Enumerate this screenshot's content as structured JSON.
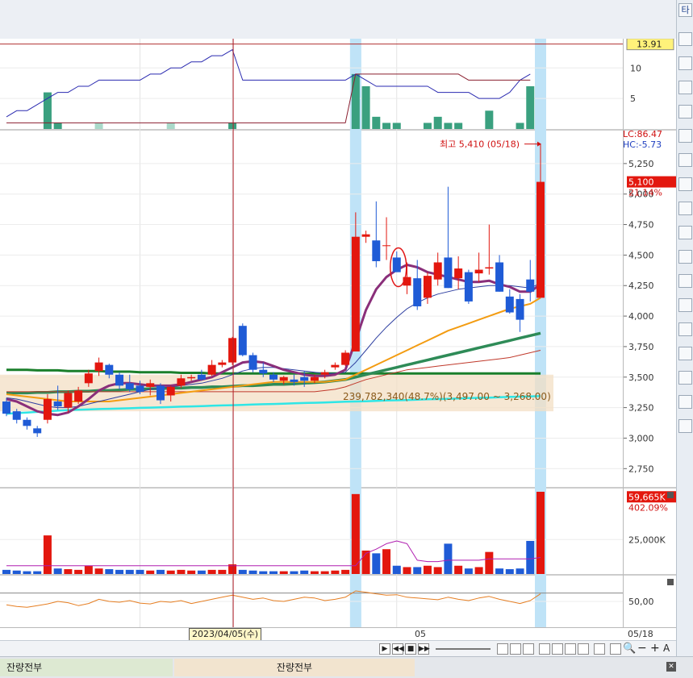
{
  "window": {
    "top_right_glyph": "타"
  },
  "bottom_tabs": [
    {
      "label": "잔량전부"
    },
    {
      "label": "잔량전부"
    }
  ],
  "date_axis": {
    "crosshair_date": "2023/04/05(수)",
    "mid_label": "05",
    "last_label": "05/18"
  },
  "colors": {
    "up": "#e3170e",
    "down": "#1f5bd6",
    "ma5": "#8a2f7a",
    "ma10": "#f39c12",
    "ma20": "#2e8b57",
    "ma60": "#1a7f2b",
    "ma120": "#c0392b",
    "ma_long": "#2ee6e6",
    "highlight": "#bfe3f7",
    "band": "#f3dfc4"
  },
  "chart_data": [
    {
      "type": "bar+line",
      "panel": "indicator-top",
      "yticks": [
        5,
        10
      ],
      "ylim": [
        0,
        14
      ],
      "current_value_label": "13.91",
      "bars": [
        0,
        0,
        0,
        0,
        6,
        1,
        0,
        0,
        0,
        1,
        0,
        0,
        0,
        0,
        0,
        0,
        1,
        0,
        0,
        0,
        0,
        0,
        1,
        0,
        0,
        0,
        0,
        0,
        0,
        0,
        0,
        0,
        0,
        0,
        9,
        7,
        2,
        1,
        1,
        0,
        0,
        1,
        2,
        1,
        1,
        0,
        0,
        3,
        0,
        0,
        1,
        7
      ],
      "line1": [
        2,
        3,
        3,
        4,
        5,
        6,
        6,
        7,
        7,
        8,
        8,
        8,
        8,
        8,
        9,
        9,
        10,
        10,
        11,
        11,
        12,
        12,
        13,
        8,
        8,
        8,
        8,
        8,
        8,
        8,
        8,
        8,
        8,
        8,
        9,
        8,
        7,
        7,
        7,
        7,
        7,
        7,
        6,
        6,
        6,
        6,
        5,
        5,
        5,
        6,
        8,
        9
      ],
      "line2": [
        1,
        1,
        1,
        1,
        1,
        1,
        1,
        1,
        1,
        1,
        1,
        1,
        1,
        1,
        1,
        1,
        1,
        1,
        1,
        1,
        1,
        1,
        1,
        1,
        1,
        1,
        1,
        1,
        1,
        1,
        1,
        1,
        1,
        1,
        9,
        9,
        9,
        9,
        9,
        9,
        9,
        9,
        9,
        9,
        9,
        8,
        8,
        8,
        8,
        8,
        8,
        8
      ]
    },
    {
      "type": "candlestick",
      "panel": "price",
      "yticks": [
        2750,
        3000,
        3250,
        3500,
        3750,
        4000,
        4250,
        4500,
        4750,
        5000,
        5250
      ],
      "ylim": [
        2600,
        5520
      ],
      "lc_label": "LC:86.47",
      "hc_label": "HC:-5.73",
      "current_price_label": "5,100",
      "current_change_label": "21.14%",
      "annotation_max": "최고 5,410 (05/18)",
      "annotation_range": "239,782,340(48.7%)(3,497.00 ~ 3,268.00)",
      "ohlc": [
        [
          3300,
          3330,
          3180,
          3200
        ],
        [
          3220,
          3240,
          3120,
          3150
        ],
        [
          3150,
          3170,
          3070,
          3100
        ],
        [
          3080,
          3100,
          3010,
          3040
        ],
        [
          3150,
          3360,
          3120,
          3320
        ],
        [
          3300,
          3430,
          3230,
          3260
        ],
        [
          3250,
          3390,
          3210,
          3370
        ],
        [
          3300,
          3420,
          3280,
          3390
        ],
        [
          3450,
          3560,
          3420,
          3530
        ],
        [
          3550,
          3660,
          3510,
          3620
        ],
        [
          3600,
          3610,
          3490,
          3520
        ],
        [
          3520,
          3540,
          3400,
          3430
        ],
        [
          3450,
          3520,
          3380,
          3400
        ],
        [
          3430,
          3470,
          3360,
          3380
        ],
        [
          3420,
          3480,
          3350,
          3450
        ],
        [
          3430,
          3450,
          3280,
          3310
        ],
        [
          3350,
          3430,
          3300,
          3420
        ],
        [
          3430,
          3520,
          3410,
          3490
        ],
        [
          3490,
          3520,
          3470,
          3500
        ],
        [
          3520,
          3560,
          3470,
          3480
        ],
        [
          3520,
          3640,
          3510,
          3600
        ],
        [
          3600,
          3640,
          3580,
          3620
        ],
        [
          3620,
          3830,
          3600,
          3820
        ],
        [
          3920,
          3940,
          3670,
          3680
        ],
        [
          3680,
          3700,
          3540,
          3560
        ],
        [
          3560,
          3620,
          3500,
          3530
        ],
        [
          3520,
          3540,
          3460,
          3480
        ],
        [
          3470,
          3510,
          3440,
          3500
        ],
        [
          3480,
          3520,
          3430,
          3460
        ],
        [
          3500,
          3550,
          3420,
          3470
        ],
        [
          3470,
          3520,
          3450,
          3500
        ],
        [
          3520,
          3560,
          3490,
          3540
        ],
        [
          3580,
          3620,
          3560,
          3600
        ],
        [
          3600,
          3720,
          3590,
          3700
        ],
        [
          3710,
          4850,
          3710,
          4650
        ],
        [
          4650,
          4700,
          4600,
          4670
        ],
        [
          4620,
          4940,
          4400,
          4450
        ],
        [
          4580,
          4810,
          4460,
          4580
        ],
        [
          4480,
          4530,
          4360,
          4360
        ],
        [
          4250,
          4440,
          4180,
          4320
        ],
        [
          4310,
          4460,
          4050,
          4080
        ],
        [
          4150,
          4360,
          4100,
          4330
        ],
        [
          4300,
          4520,
          4250,
          4440
        ],
        [
          4480,
          5060,
          4230,
          4230
        ],
        [
          4310,
          4490,
          4220,
          4390
        ],
        [
          4360,
          4380,
          4100,
          4120
        ],
        [
          4350,
          4520,
          4280,
          4380
        ],
        [
          4390,
          4750,
          4340,
          4400
        ],
        [
          4440,
          4500,
          4200,
          4200
        ],
        [
          4160,
          4220,
          4020,
          4030
        ],
        [
          4140,
          4180,
          3870,
          3970
        ],
        [
          4300,
          4460,
          4120,
          4200
        ],
        [
          4150,
          5410,
          4150,
          5100
        ]
      ],
      "ma5": [
        3320,
        3300,
        3260,
        3220,
        3200,
        3190,
        3210,
        3260,
        3320,
        3390,
        3430,
        3450,
        3450,
        3440,
        3430,
        3430,
        3430,
        3440,
        3460,
        3480,
        3500,
        3540,
        3580,
        3620,
        3630,
        3620,
        3590,
        3560,
        3540,
        3520,
        3510,
        3510,
        3520,
        3560,
        3800,
        4050,
        4220,
        4320,
        4380,
        4420,
        4400,
        4360,
        4340,
        4320,
        4300,
        4280,
        4280,
        4290,
        4260,
        4240,
        4200,
        4200,
        4260
      ],
      "ma10": [
        3330,
        3320,
        3300,
        3280,
        3260,
        3250,
        3250,
        3260,
        3280,
        3300,
        3320,
        3340,
        3360,
        3380,
        3400,
        3410,
        3420,
        3430,
        3440,
        3450,
        3470,
        3490,
        3520,
        3550,
        3570,
        3580,
        3580,
        3570,
        3560,
        3550,
        3540,
        3530,
        3530,
        3540,
        3620,
        3720,
        3820,
        3910,
        3990,
        4060,
        4110,
        4150,
        4180,
        4200,
        4220,
        4230,
        4240,
        4250,
        4250,
        4250,
        4240,
        4230,
        4270
      ],
      "ma20": [
        3360,
        3350,
        3340,
        3330,
        3320,
        3310,
        3300,
        3300,
        3300,
        3300,
        3300,
        3310,
        3320,
        3330,
        3340,
        3350,
        3360,
        3370,
        3380,
        3390,
        3400,
        3410,
        3420,
        3430,
        3440,
        3450,
        3460,
        3460,
        3460,
        3460,
        3460,
        3460,
        3470,
        3480,
        3520,
        3560,
        3600,
        3640,
        3680,
        3720,
        3760,
        3800,
        3840,
        3880,
        3910,
        3940,
        3970,
        4000,
        4030,
        4060,
        4080,
        4100,
        4150
      ],
      "ma60": [
        3370,
        3370,
        3370,
        3375,
        3375,
        3380,
        3380,
        3385,
        3385,
        3390,
        3390,
        3395,
        3400,
        3400,
        3405,
        3405,
        3410,
        3410,
        3415,
        3415,
        3420,
        3420,
        3425,
        3430,
        3430,
        3435,
        3440,
        3440,
        3445,
        3450,
        3455,
        3460,
        3470,
        3480,
        3500,
        3520,
        3540,
        3560,
        3580,
        3600,
        3620,
        3640,
        3660,
        3680,
        3700,
        3720,
        3740,
        3760,
        3780,
        3800,
        3820,
        3840,
        3860
      ],
      "ma120": [
        3560,
        3560,
        3560,
        3555,
        3555,
        3555,
        3550,
        3550,
        3550,
        3550,
        3545,
        3545,
        3545,
        3540,
        3540,
        3540,
        3540,
        3535,
        3535,
        3535,
        3530,
        3530,
        3530,
        3530,
        3530,
        3530,
        3530,
        3530,
        3530,
        3530,
        3530,
        3530,
        3530,
        3530,
        3530,
        3530,
        3530,
        3530,
        3530,
        3530,
        3530,
        3530,
        3530,
        3530,
        3530,
        3530,
        3530,
        3530,
        3530,
        3530,
        3530,
        3530,
        3530
      ],
      "ma_long": [
        3200,
        3205,
        3210,
        3215,
        3220,
        3225,
        3230,
        3232,
        3235,
        3238,
        3240,
        3242,
        3245,
        3248,
        3250,
        3252,
        3255,
        3258,
        3260,
        3262,
        3265,
        3268,
        3270,
        3272,
        3275,
        3278,
        3280,
        3282,
        3285,
        3288,
        3290,
        3292,
        3295,
        3298,
        3300,
        3302,
        3305,
        3308,
        3310,
        3312,
        3315,
        3318,
        3320,
        3322,
        3325,
        3328,
        3330,
        3332,
        3335,
        3338,
        3340,
        3342,
        3345
      ],
      "ma_red_thin": [
        3380,
        3380,
        3380,
        3380,
        3380,
        3380,
        3380,
        3380,
        3380,
        3380,
        3380,
        3380,
        3380,
        3380,
        3380,
        3380,
        3380,
        3380,
        3380,
        3380,
        3380,
        3380,
        3380,
        3380,
        3380,
        3380,
        3380,
        3380,
        3380,
        3380,
        3380,
        3390,
        3400,
        3420,
        3450,
        3480,
        3500,
        3520,
        3540,
        3560,
        3570,
        3580,
        3590,
        3600,
        3610,
        3620,
        3630,
        3640,
        3650,
        3660,
        3680,
        3700,
        3720
      ]
    },
    {
      "type": "bar",
      "panel": "volume",
      "yticks": [
        25000
      ],
      "ytick_labels": [
        "25,000K"
      ],
      "ylim": [
        0,
        62000
      ],
      "current_volume_label": "59,665K",
      "current_change_label": "402.09%",
      "values": [
        3000,
        2500,
        2000,
        2000,
        28000,
        4000,
        3500,
        3000,
        6000,
        4000,
        3500,
        3000,
        3000,
        3000,
        2500,
        3000,
        2500,
        3000,
        2500,
        2500,
        3000,
        3000,
        7000,
        3000,
        2500,
        2000,
        2000,
        2000,
        2000,
        2500,
        2000,
        2000,
        2500,
        3000,
        58000,
        17000,
        15000,
        18000,
        6000,
        5000,
        5000,
        6000,
        5000,
        22000,
        6000,
        4000,
        5000,
        16000,
        4000,
        3500,
        4000,
        24000,
        59665
      ],
      "ma_line": [
        6000,
        6000,
        6000,
        6000,
        6000,
        6000,
        6000,
        6000,
        6000,
        6000,
        6000,
        6000,
        6000,
        6000,
        6000,
        6000,
        6000,
        6000,
        6000,
        6000,
        6000,
        6000,
        6000,
        6000,
        6000,
        6000,
        6000,
        6000,
        6000,
        6000,
        6000,
        6000,
        6000,
        6000,
        6000,
        15000,
        18000,
        22000,
        24000,
        22000,
        10000,
        9000,
        9000,
        10000,
        10000,
        10000,
        10000,
        11000,
        11000,
        11000,
        11000,
        11000,
        12000
      ]
    },
    {
      "type": "line",
      "panel": "oscillator-bottom",
      "yticks": [
        50
      ],
      "ytick_labels": [
        "50,00"
      ],
      "ylim": [
        0,
        100
      ],
      "values": [
        42,
        38,
        36,
        40,
        44,
        50,
        47,
        40,
        45,
        55,
        50,
        48,
        52,
        46,
        44,
        50,
        48,
        52,
        45,
        50,
        55,
        60,
        65,
        60,
        55,
        58,
        52,
        50,
        55,
        60,
        58,
        52,
        55,
        60,
        75,
        72,
        68,
        65,
        66,
        60,
        58,
        56,
        54,
        60,
        55,
        52,
        58,
        62,
        55,
        50,
        45,
        52,
        68
      ]
    }
  ]
}
